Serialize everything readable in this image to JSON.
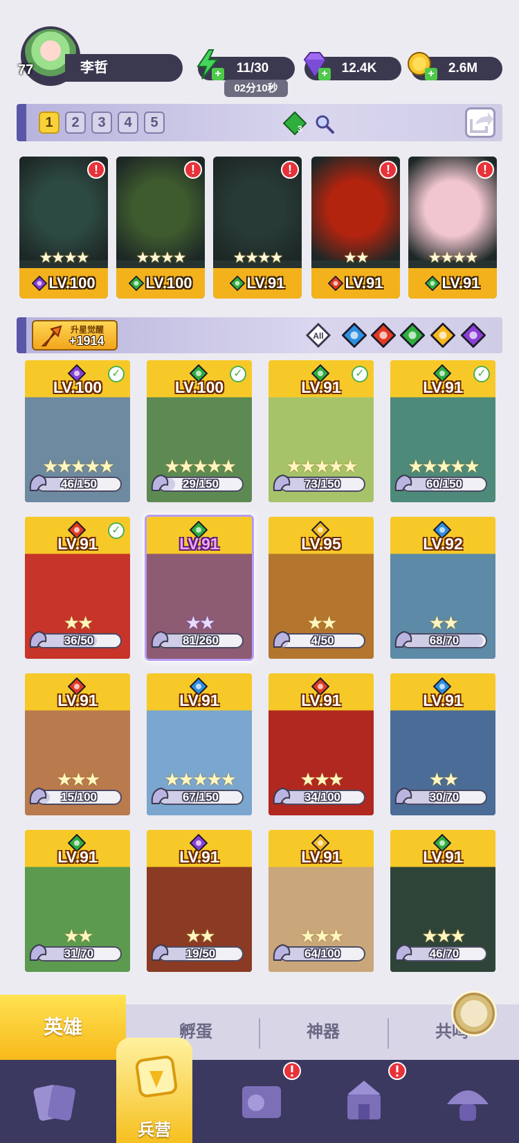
{
  "player": {
    "level": "77",
    "name": "李哲"
  },
  "resources": {
    "energy": "11/30",
    "energy_timer": "02分10秒",
    "gems": "12.4K",
    "gold": "2.6M"
  },
  "team_tabs": [
    "1",
    "2",
    "3",
    "4",
    "5"
  ],
  "team_gem_count": "3",
  "team": [
    {
      "level": "LV.100",
      "stars": "★★★★",
      "element": "dark",
      "bg": "#2d4a42",
      "alert": "!"
    },
    {
      "level": "LV.100",
      "stars": "★★★★",
      "element": "wind",
      "bg": "#3e5b2e",
      "alert": "!"
    },
    {
      "level": "LV.91",
      "stars": "★★★★",
      "element": "wind",
      "bg": "#273a36",
      "alert": "!"
    },
    {
      "level": "LV.91",
      "stars": "★★",
      "element": "fire",
      "bg": "#b3240f",
      "alert": "!"
    },
    {
      "level": "LV.91",
      "stars": "★★★★",
      "element": "wind",
      "bg": "#f2c6cf",
      "alert": "!"
    }
  ],
  "awaken": {
    "label": "升星觉醒",
    "value": "+1914"
  },
  "filters": [
    "All",
    "water",
    "fire",
    "wind",
    "light",
    "dark"
  ],
  "filter_all_label": "All",
  "heroes": [
    {
      "level": "LV.100",
      "element": "dark",
      "stars": "★★★★★",
      "shards": "46/150",
      "progress": 0.31,
      "checked": true,
      "selected": false,
      "art": "#6d8aa1"
    },
    {
      "level": "LV.100",
      "element": "wind",
      "stars": "★★★★★",
      "shards": "29/150",
      "progress": 0.19,
      "checked": true,
      "selected": false,
      "art": "#5d8a53"
    },
    {
      "level": "LV.91",
      "element": "wind",
      "stars": "★★★★★",
      "shards": "73/150",
      "progress": 0.49,
      "checked": true,
      "selected": false,
      "art": "#a7c36a"
    },
    {
      "level": "LV.91",
      "element": "wind",
      "stars": "★★★★★",
      "shards": "60/150",
      "progress": 0.4,
      "checked": true,
      "selected": false,
      "art": "#4d8a79"
    },
    {
      "level": "LV.91",
      "element": "fire",
      "stars": "★★",
      "shards": "36/50",
      "progress": 0.72,
      "checked": true,
      "selected": false,
      "art": "#c6342a"
    },
    {
      "level": "LV.91",
      "element": "wind",
      "stars": "★★",
      "shards": "81/260",
      "progress": 0.31,
      "checked": false,
      "selected": true,
      "art": "#8d5b72"
    },
    {
      "level": "LV.95",
      "element": "light",
      "stars": "★★",
      "shards": "4/50",
      "progress": 0.08,
      "checked": false,
      "selected": false,
      "art": "#b4762f"
    },
    {
      "level": "LV.92",
      "element": "water",
      "stars": "★★",
      "shards": "68/70",
      "progress": 0.97,
      "checked": false,
      "selected": false,
      "art": "#5d8aa6"
    },
    {
      "level": "LV.91",
      "element": "fire",
      "stars": "★★★",
      "shards": "15/100",
      "progress": 0.15,
      "checked": false,
      "selected": false,
      "art": "#b97a4d"
    },
    {
      "level": "LV.91",
      "element": "water",
      "stars": "★★★★★",
      "shards": "67/150",
      "progress": 0.45,
      "checked": false,
      "selected": false,
      "art": "#7aa6cf"
    },
    {
      "level": "LV.91",
      "element": "fire",
      "stars": "★★★",
      "shards": "34/100",
      "progress": 0.34,
      "checked": false,
      "selected": false,
      "art": "#b0281f"
    },
    {
      "level": "LV.91",
      "element": "water",
      "stars": "★★",
      "shards": "30/70",
      "progress": 0.43,
      "checked": false,
      "selected": false,
      "art": "#4a6c97"
    },
    {
      "level": "LV.91",
      "element": "wind",
      "stars": "★★",
      "shards": "31/70",
      "progress": 0.44,
      "checked": false,
      "selected": false,
      "art": "#5c9a4f"
    },
    {
      "level": "LV.91",
      "element": "dark",
      "stars": "★★",
      "shards": "19/50",
      "progress": 0.38,
      "checked": false,
      "selected": false,
      "art": "#8b3b24"
    },
    {
      "level": "LV.91",
      "element": "light",
      "stars": "★★★",
      "shards": "64/100",
      "progress": 0.64,
      "checked": false,
      "selected": false,
      "art": "#c9a77a"
    },
    {
      "level": "LV.91",
      "element": "wind",
      "stars": "★★★",
      "shards": "46/70",
      "progress": 0.66,
      "checked": false,
      "selected": false,
      "art": "#2f4438"
    }
  ],
  "subtabs": [
    "英雄",
    "孵蛋",
    "神器",
    "共鸣"
  ],
  "nav": {
    "barracks_label": "兵营"
  },
  "colors": {
    "accent_yellow": "#f7c928",
    "panel_purple": "#3b3950",
    "alert_red": "#e8323a",
    "element_fire": "#e23a22",
    "element_water": "#2f8fe0",
    "element_wind": "#2fae3e",
    "element_light": "#f4b61d",
    "element_dark": "#8b3fd6"
  }
}
